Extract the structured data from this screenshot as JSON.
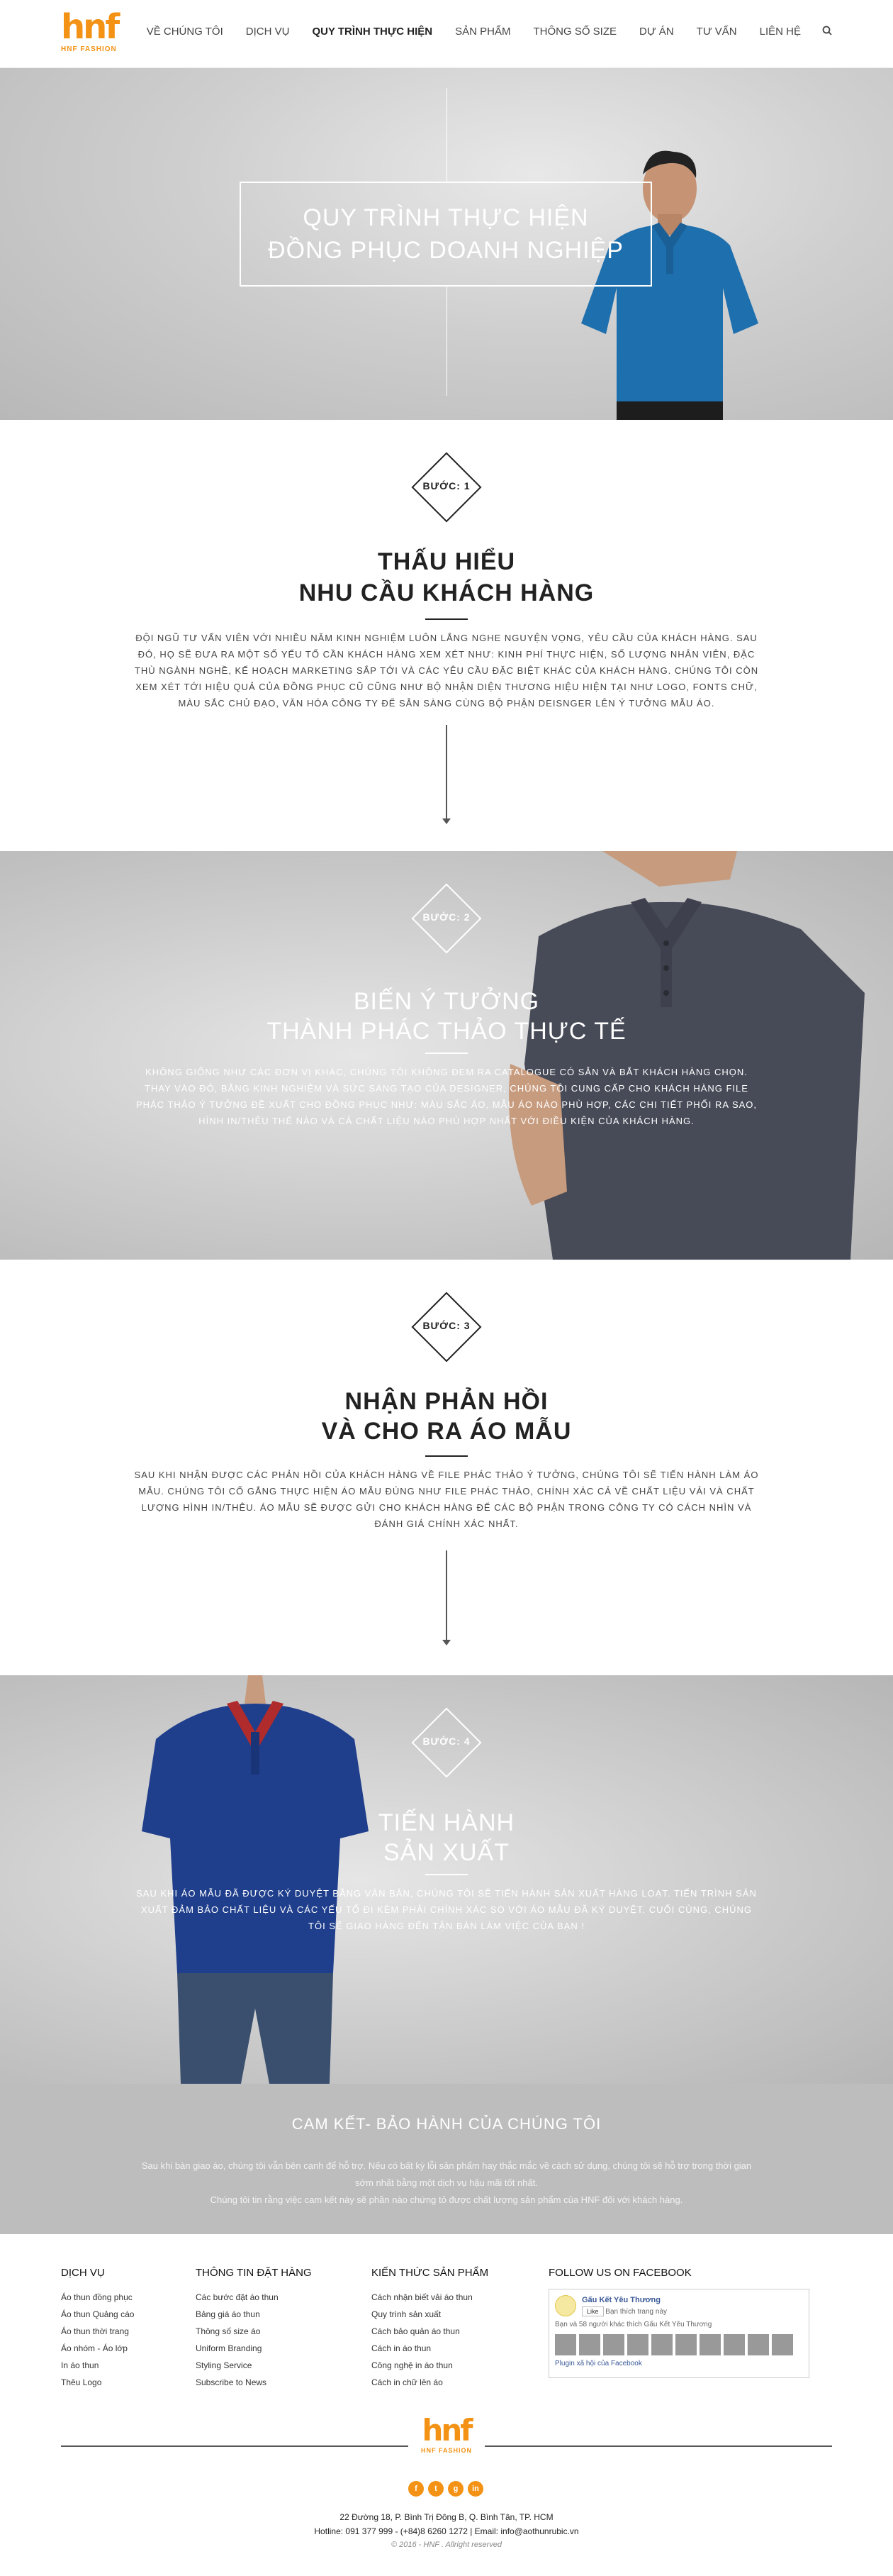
{
  "brand": {
    "mark": "hnf",
    "sub": "HNF FASHION"
  },
  "nav": {
    "items": [
      "VỀ CHÚNG TÔI",
      "DỊCH VỤ",
      "QUY TRÌNH THỰC HIỆN",
      "SẢN PHẨM",
      "THÔNG SỐ SIZE",
      "DỰ ÁN",
      "TƯ VẤN",
      "LIÊN HỆ"
    ],
    "active_index": 2
  },
  "hero": {
    "line1": "QUY TRÌNH THỰC HIỆN",
    "line2": "ĐỒNG PHỤC DOANH NGHIỆP"
  },
  "steps": [
    {
      "label": "BƯỚC: 1",
      "title1": "THẤU HIỂU",
      "title2": "NHU CẦU KHÁCH HÀNG",
      "text": "ĐỘI NGŨ TƯ VẤN VIÊN VỚI NHIỀU NĂM KINH NGHIỆM LUÔN LẮNG NGHE NGUYỆN VỌNG, YÊU CẦU CỦA KHÁCH HÀNG. SAU ĐÓ, HỌ SẼ ĐƯA RA MỘT SỐ YẾU TỐ CẦN KHÁCH HÀNG XEM XÉT NHƯ: KINH PHÍ THỰC HIỆN, SỐ LƯỢNG NHÂN VIÊN, ĐẶC THÙ NGÀNH NGHỀ, KẾ HOẠCH MARKETING SẮP TỚI VÀ CÁC YÊU CẦU ĐẶC BIỆT KHÁC CỦA KHÁCH HÀNG. CHÚNG TÔI CÒN XEM XÉT TỚI HIỆU QUẢ CỦA ĐỒNG PHỤC CŨ CŨNG NHƯ BỘ NHẬN DIỆN THƯƠNG HIỆU HIỆN TẠI NHƯ LOGO, FONTS CHỮ, MÀU SẮC CHỦ ĐẠO, VĂN HÓA CÔNG TY ĐỂ SẴN SÀNG CÙNG BỘ PHẬN DEISNGER LÊN Ý TƯỞNG MẪU ÁO."
    },
    {
      "label": "BƯỚC: 2",
      "title1": "BIẾN Ý TƯỞNG",
      "title2": "THÀNH PHÁC THẢO THỰC TẾ",
      "text": "KHÔNG GIỐNG NHƯ CÁC ĐƠN VỊ KHÁC, CHÚNG TÔI KHÔNG ĐEM RA CATALOGUE CÓ SẴN VÀ BẮT KHÁCH HÀNG CHỌN. THAY VÀO ĐÓ, BẰNG KINH NGHIỆM VÀ SỨC SÁNG TẠO CỦA DESIGNER, CHÚNG TÔI CUNG CẤP CHO KHÁCH HÀNG FILE PHÁC THẢO Ý TƯỞNG ĐỀ XUẤT CHO ĐỒNG PHỤC NHƯ: MÀU SẮC ÁO, MẪU ÁO NÀO PHÙ HỢP, CÁC CHI TIẾT PHỐI RA SAO, HÌNH IN/THÊU THẾ NÀO VÀ CẢ CHẤT LIỆU NÀO PHÙ HỢP NHẤT VỚI ĐIỀU KIỆN CỦA KHÁCH HÀNG."
    },
    {
      "label": "BƯỚC: 3",
      "title1": "NHẬN PHẢN HỒI",
      "title2": "VÀ CHO RA ÁO MẪU",
      "text": "SAU KHI NHẬN ĐƯỢC CÁC PHẢN HỒI CỦA KHÁCH HÀNG VỀ FILE PHÁC THẢO Ý TƯỞNG, CHÚNG TÔI SẼ TIẾN HÀNH LÀM ÁO MẪU. CHÚNG TÔI CỐ GẮNG THỰC HIỆN ÁO MẪU ĐÚNG NHƯ FILE PHÁC THẢO, CHÍNH XÁC CẢ VỀ CHẤT LIỆU VẢI VÀ CHẤT LƯỢNG HÌNH IN/THÊU. ÁO MẪU SẼ ĐƯỢC GỬI CHO KHÁCH HÀNG ĐỂ CÁC BỘ PHẬN TRONG CÔNG TY CÓ CÁCH NHÌN VÀ ĐÁNH GIÁ CHÍNH XÁC NHẤT."
    },
    {
      "label": "BƯỚC: 4",
      "title1": "TIẾN HÀNH",
      "title2": "SẢN XUẤT",
      "text": "SAU KHI ÁO MẪU ĐÃ ĐƯỢC KÝ DUYỆT BẰNG VĂN BẢN, CHÚNG TÔI SẼ TIẾN HÀNH SẢN XUẤT HÀNG LOẠT. TIẾN TRÌNH SẢN XUẤT ĐẢM BẢO CHẤT LIỆU VÀ CÁC YẾU TỐ ĐI KÈM PHẢI CHÍNH XÁC SO VỚI ÁO MẪU ĐÃ KÝ DUYỆT. CUỐI CÙNG, CHÚNG TÔI SẼ GIAO HÀNG ĐẾN TẬN BÀN LÀM VIỆC CỦA BẠN !"
    }
  ],
  "commit": {
    "title": "CAM KẾT- BẢO HÀNH CỦA CHÚNG TÔI",
    "line1": "Sau khi bàn giao áo, chúng tôi vẫn bên cạnh để hỗ trợ. Nếu có bất kỳ lỗi sản phẩm hay thắc mắc về cách sử dụng, chúng tôi sẽ hỗ trợ trong thời gian sớm nhất bằng một dịch vụ hậu mãi tốt nhất.",
    "line2": "Chúng tôi tin rằng việc cam kết này sẽ phần nào chứng tỏ được chất lượng sản phẩm của HNF đối với khách hàng."
  },
  "footer": {
    "col1": {
      "title": "DỊCH VỤ",
      "items": [
        "Áo thun đồng phục",
        "Áo thun Quảng cáo",
        "Áo thun thời trang",
        "Áo nhóm - Áo lớp",
        "In áo thun",
        "Thêu Logo"
      ]
    },
    "col2": {
      "title": "THÔNG TIN ĐẶT HÀNG",
      "items": [
        "Các bước đặt áo thun",
        "Bảng giá áo thun",
        "Thông số size áo",
        "Uniform Branding",
        "Styling Service",
        "Subscribe to News"
      ]
    },
    "col3": {
      "title": "KIẾN THỨC SẢN PHẨM",
      "items": [
        "Cách nhận biết vải áo thun",
        "Quy trình sản xuất",
        "Cách bảo quản áo thun",
        "Cách in áo thun",
        "Công nghệ in áo thun",
        "Cách in chữ lên áo"
      ]
    },
    "col4": {
      "title": "FOLLOW US ON FACEBOOK",
      "page_name": "Gấu Kết Yêu Thương",
      "like": "Like",
      "like_count": "Bạn thích trang này",
      "fans": "Bạn và 58 người khác thích Gấu Kết Yêu Thương",
      "plugin": "Plugin xã hội của Facebook"
    },
    "address": "22 Đường 18, P. Bình Trị Đông B, Q. Bình Tân, TP. HCM",
    "hotline": "Hotline: 091 377 999 - (+84)8 6260 1272  |  Email: info@aothunrubic.vn",
    "copyright": "© 2016 - HNF . Allright reserved",
    "social": [
      "f",
      "t",
      "g",
      "in"
    ]
  },
  "colors": {
    "brand_orange": "#f39214",
    "grey_bg": "#c8c8c8",
    "shirt_blue": "#1f6fb0",
    "shirt_grey": "#4a4d5a",
    "shirt_navy": "#1f3d8a"
  }
}
